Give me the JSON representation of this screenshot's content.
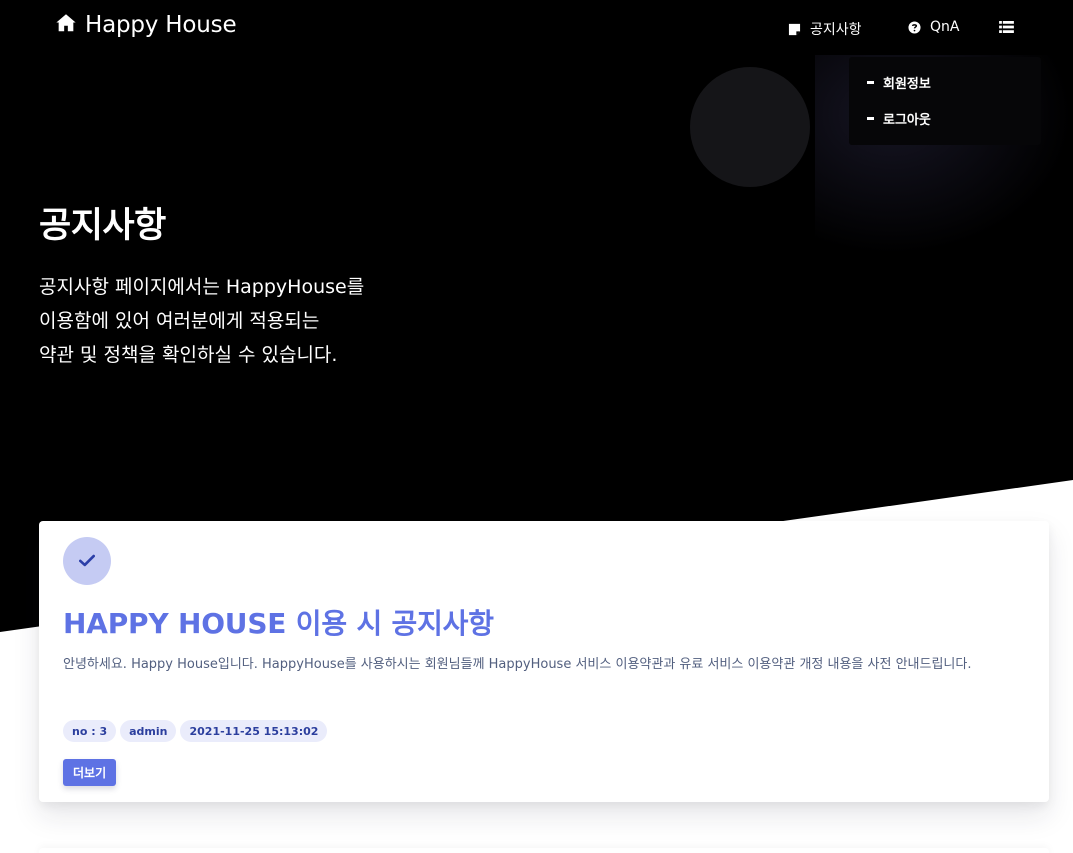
{
  "navbar": {
    "brand": "Happy House",
    "brand_icon": "home-icon",
    "items": [
      {
        "label": "공지사항",
        "icon": "sticky-note-icon"
      },
      {
        "label": "QnA",
        "icon": "question-circle-icon"
      },
      {
        "label": "",
        "icon": "list-icon"
      }
    ]
  },
  "dropdown": {
    "items": [
      {
        "label": "회원정보"
      },
      {
        "label": "로그아웃"
      }
    ]
  },
  "hero": {
    "title": "공지사항",
    "description_lines": [
      "공지사항 페이지에서는 HappyHouse를",
      "이용함에 있어 여러분에게 적용되는",
      "약관 및 정책을 확인하실 수 있습니다."
    ]
  },
  "notice": {
    "icon": "check-icon",
    "title": "HAPPY HOUSE 이용 시 공지사항",
    "body": "안녕하세요. Happy House입니다. HappyHouse를 사용하시는 회원님들께 HappyHouse 서비스 이용약관과 유료 서비스 이용약관 개정 내용을 사전 안내드립니다.",
    "badges": {
      "no": "no : 3",
      "author": "admin",
      "date": "2021-11-25 15:13:02"
    },
    "more_label": "더보기"
  },
  "colors": {
    "hero_bg": "#000000",
    "accent": "#5e72e4",
    "icon_circle": "#c5cbf3",
    "badge_bg": "#eaecfb",
    "body_text": "#525f7f"
  }
}
